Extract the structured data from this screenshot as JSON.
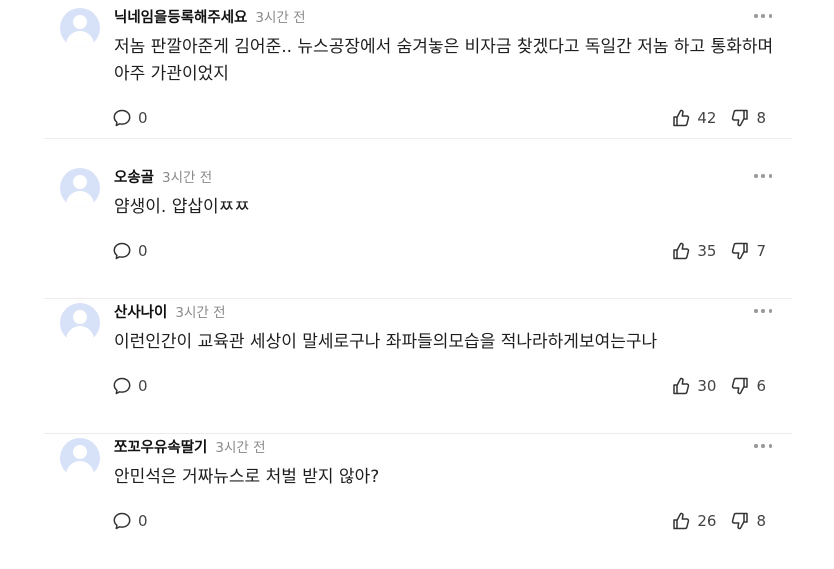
{
  "comments": [
    {
      "nickname": "닉네임을등록해주세요",
      "time": "3시간 전",
      "text": "저놈 판깔아준게 김어준.. 뉴스공장에서 숨겨놓은 비자금 찾겠다고 독일간 저놈 하고 통화하며 아주 가관이었지",
      "replies": "0",
      "likes": "42",
      "dislikes": "8"
    },
    {
      "nickname": "오송골",
      "time": "3시간 전",
      "text": "얌생이. 얍삽이ㅉㅉ",
      "replies": "0",
      "likes": "35",
      "dislikes": "7"
    },
    {
      "nickname": "산사나이",
      "time": "3시간 전",
      "text": "이런인간이 교육관 세상이 말세로구나 좌파들의모습을 적나라하게보여는구나",
      "replies": "0",
      "likes": "30",
      "dislikes": "6"
    },
    {
      "nickname": "쪼꼬우유속딸기",
      "time": "3시간 전",
      "text": "안민석은 거짜뉴스로 처벌 받지 않아?",
      "replies": "0",
      "likes": "26",
      "dislikes": "8"
    }
  ],
  "icons": {
    "avatar": "default-profile-avatar",
    "more": "more-options-icon",
    "reply": "speech-bubble-icon",
    "like": "thumbs-up-icon",
    "dislike": "thumbs-down-icon"
  },
  "colors": {
    "avatar_bg": "#d7e2f8",
    "divider": "#ececec",
    "meta_gray": "#8a8a8a"
  }
}
